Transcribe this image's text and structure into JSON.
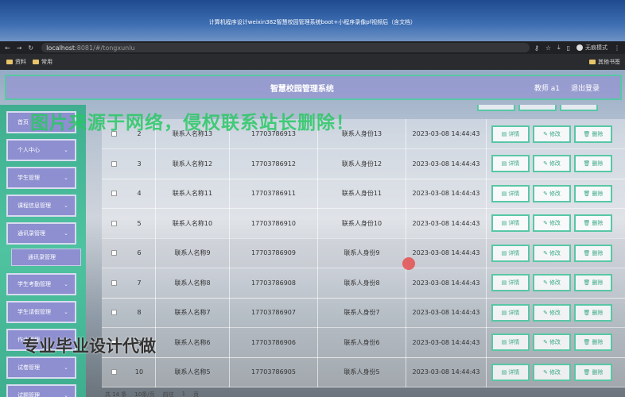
{
  "video_title": "计算机程序设计weixin382智慧校园管理系统boot+小程序录像pf视频后（含文档）",
  "browser": {
    "url_host": "localhost",
    "url_rest": ":8081/#/tongxunlu",
    "incognito_label": "无痕模式",
    "bookmarks": [
      "资料",
      "常用"
    ],
    "other_bookmarks": "其他书签"
  },
  "header": {
    "title": "智慧校园管理系统",
    "user": "教师 a1",
    "logout": "退出登录"
  },
  "sidebar": {
    "items": [
      {
        "label": "首页",
        "chevron": false
      },
      {
        "label": "个人中心",
        "chevron": true
      },
      {
        "label": "学生管理",
        "chevron": true
      },
      {
        "label": "课程信息管理",
        "chevron": true
      },
      {
        "label": "通讯录管理",
        "chevron": true
      },
      {
        "label": "学生考勤管理",
        "chevron": true
      },
      {
        "label": "学生请假管理",
        "chevron": true
      },
      {
        "label": "作业管理",
        "chevron": true
      },
      {
        "label": "试卷管理",
        "chevron": true
      },
      {
        "label": "试题管理",
        "chevron": true
      }
    ],
    "submenu": "通讯录管理"
  },
  "table": {
    "rows": [
      {
        "idx": "2",
        "name": "联系人名称13",
        "phone": "17703786913",
        "idcard": "联系人身份13",
        "time": "2023-03-08 14:44:43"
      },
      {
        "idx": "3",
        "name": "联系人名称12",
        "phone": "17703786912",
        "idcard": "联系人身份12",
        "time": "2023-03-08 14:44:43"
      },
      {
        "idx": "4",
        "name": "联系人名称11",
        "phone": "17703786911",
        "idcard": "联系人身份11",
        "time": "2023-03-08 14:44:43"
      },
      {
        "idx": "5",
        "name": "联系人名称10",
        "phone": "17703786910",
        "idcard": "联系人身份10",
        "time": "2023-03-08 14:44:43"
      },
      {
        "idx": "6",
        "name": "联系人名称9",
        "phone": "17703786909",
        "idcard": "联系人身份9",
        "time": "2023-03-08 14:44:43"
      },
      {
        "idx": "7",
        "name": "联系人名称8",
        "phone": "17703786908",
        "idcard": "联系人身份8",
        "time": "2023-03-08 14:44:43"
      },
      {
        "idx": "8",
        "name": "联系人名称7",
        "phone": "17703786907",
        "idcard": "联系人身份7",
        "time": "2023-03-08 14:44:43"
      },
      {
        "idx": "9",
        "name": "联系人名称6",
        "phone": "17703786906",
        "idcard": "联系人身份6",
        "time": "2023-03-08 14:44:43"
      },
      {
        "idx": "10",
        "name": "联系人名称5",
        "phone": "17703786905",
        "idcard": "联系人身份5",
        "time": "2023-03-08 14:44:43"
      }
    ],
    "actions": {
      "detail": "详情",
      "edit": "修改",
      "delete": "删除"
    }
  },
  "pager": {
    "total": "共 14 条",
    "page_size": "10条/页",
    "goto": "前往",
    "page": "1",
    "unit": "页"
  },
  "overlays": {
    "watermark": "图片来源于网络，侵权联系站长删除！",
    "promo": "专业毕业设计代做"
  }
}
